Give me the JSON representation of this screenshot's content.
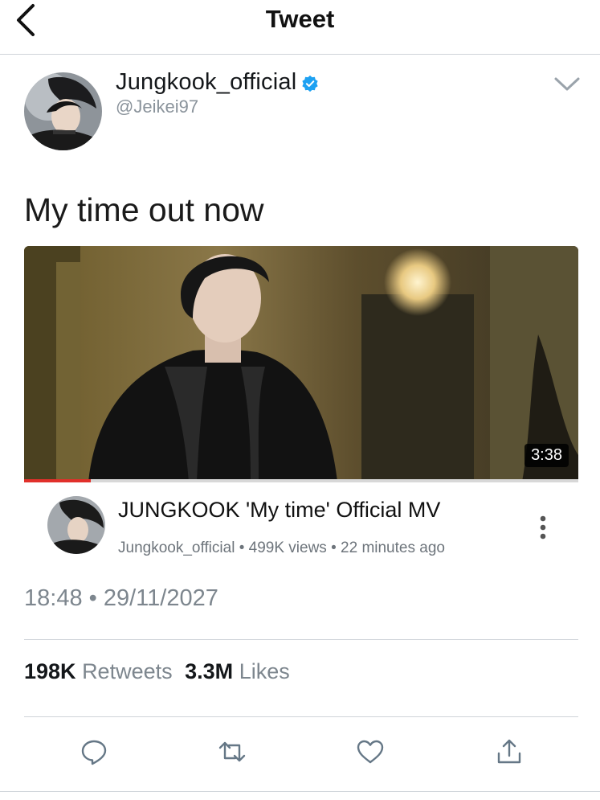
{
  "header": {
    "title": "Tweet",
    "back_icon": "chevron-left-icon"
  },
  "author": {
    "name": "Jungkook_official",
    "handle": "@Jeikei97",
    "verified_icon": "verified-badge-icon",
    "menu_icon": "chevron-down-icon"
  },
  "tweet": {
    "text": "My time out now"
  },
  "video_card": {
    "duration": "3:38",
    "progress": 0.12,
    "title": "JUNGKOOK 'My time' Official MV",
    "channel": "Jungkook_official",
    "views": "499K views",
    "age": "22 minutes ago",
    "separator": "•",
    "menu_icon": "more-vertical-icon"
  },
  "timestamp": {
    "time": "18:48",
    "separator": "•",
    "date": "29/11/2027"
  },
  "stats": {
    "retweets_count": "198K",
    "retweets_label": "Retweets",
    "likes_count": "3.3M",
    "likes_label": "Likes"
  },
  "actions": [
    "reply-icon",
    "retweet-icon",
    "like-icon",
    "share-icon"
  ],
  "colors": {
    "accent": "#1da1f2",
    "secondary_text": "#7d868e",
    "video_progress": "#e1302a"
  }
}
